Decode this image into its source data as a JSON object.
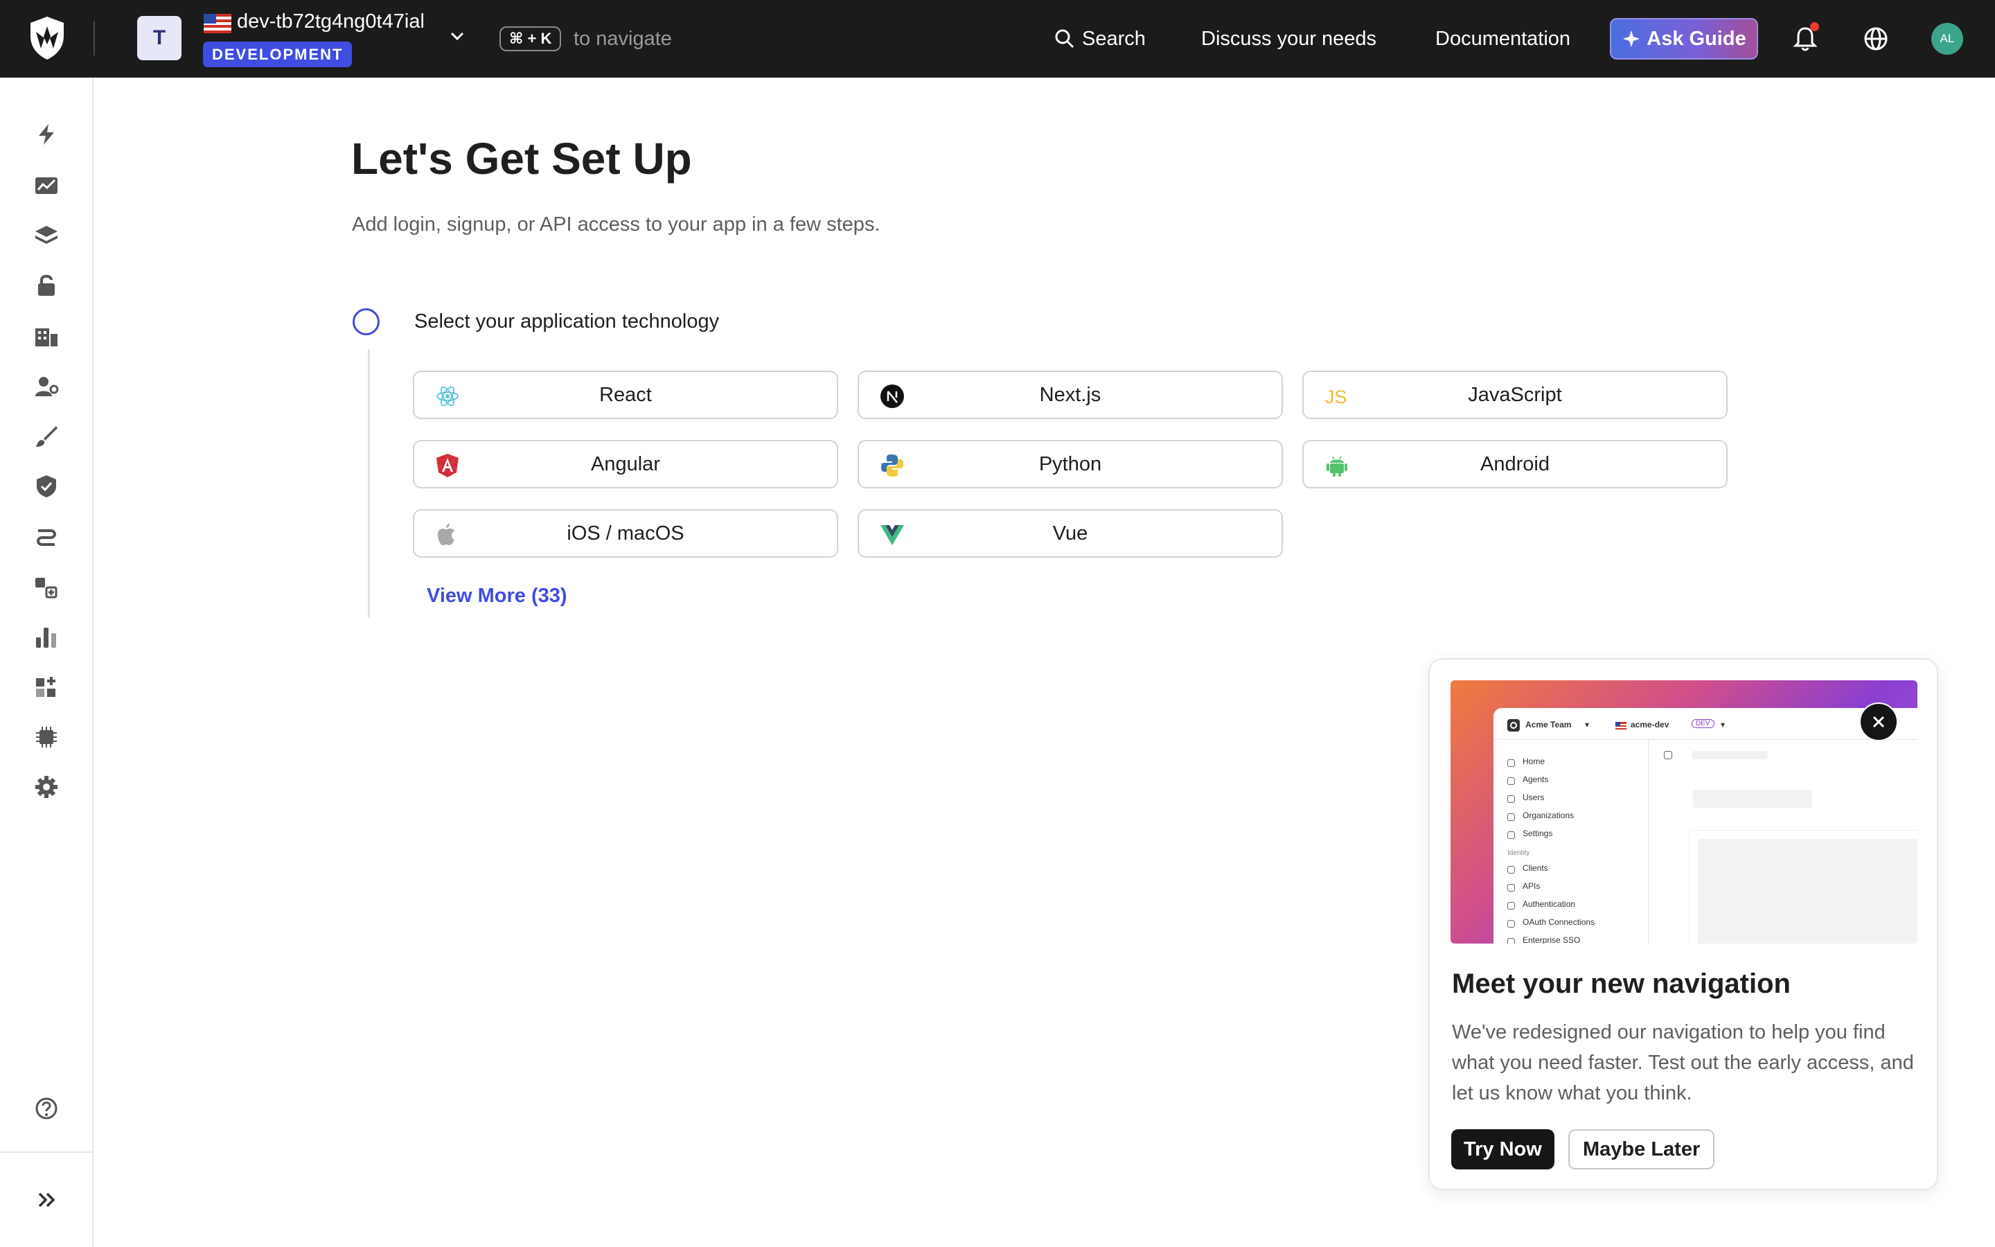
{
  "header": {
    "tenant_initial": "T",
    "tenant_name": "dev-tb72tg4ng0t47ial",
    "environment": "DEVELOPMENT",
    "shortcut": "⌘ + K",
    "shortcut_hint": "to navigate",
    "search_label": "Search",
    "discuss_label": "Discuss your needs",
    "docs_label": "Documentation",
    "ask_guide_label": "Ask Guide",
    "user_initials": "AL"
  },
  "page": {
    "title": "Let's Get Set Up",
    "subtitle": "Add login, signup, or API access to your app in a few steps.",
    "step_label": "Select your application technology",
    "view_more": "View More (33)"
  },
  "technologies": [
    {
      "label": "React",
      "icon": "react-icon"
    },
    {
      "label": "Next.js",
      "icon": "nextjs-icon"
    },
    {
      "label": "JavaScript",
      "icon": "javascript-icon"
    },
    {
      "label": "Angular",
      "icon": "angular-icon"
    },
    {
      "label": "Python",
      "icon": "python-icon"
    },
    {
      "label": "Android",
      "icon": "android-icon"
    },
    {
      "label": "iOS / macOS",
      "icon": "apple-icon"
    },
    {
      "label": "Vue",
      "icon": "vue-icon"
    }
  ],
  "sidebar": {
    "icons": [
      "bolt-icon",
      "activity-chart-icon",
      "layers-icon",
      "lock-icon",
      "organizations-icon",
      "user-management-icon",
      "branding-brush-icon",
      "security-shield-icon",
      "actions-flow-icon",
      "marketplace-icon",
      "analytics-bar-icon",
      "extensions-icon",
      "chip-icon",
      "settings-gear-icon",
      "help-icon",
      "expand-icon"
    ]
  },
  "promo": {
    "title": "Meet your new navigation",
    "body": "We've redesigned our navigation to help you find what you need faster. Test out the early access, and let us know what you think.",
    "try_now": "Try Now",
    "maybe_later": "Maybe Later",
    "mock_team": "Acme Team",
    "mock_tenant": "acme-dev",
    "mock_badge": "DEV",
    "mock_nav": [
      "Home",
      "Agents",
      "Users",
      "Organizations",
      "Settings"
    ],
    "mock_section": "Identity",
    "mock_identity": [
      "Clients",
      "APIs",
      "Authentication",
      "OAuth Connections",
      "Enterprise SSO"
    ]
  },
  "colors": {
    "accent": "#3f4de0",
    "topbar": "#1b1b1b"
  }
}
